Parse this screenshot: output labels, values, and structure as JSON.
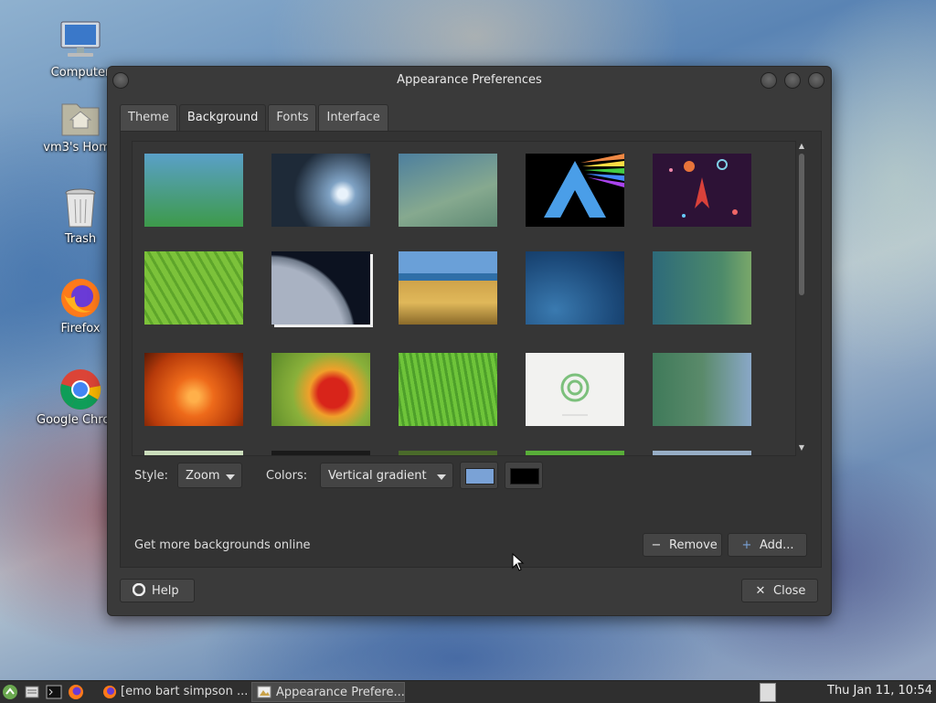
{
  "desktop": {
    "icons": [
      {
        "label": "Computer"
      },
      {
        "label": "vm3's Home"
      },
      {
        "label": "Trash"
      },
      {
        "label": "Firefox"
      },
      {
        "label": "Google Chrome"
      }
    ]
  },
  "window": {
    "title": "Appearance Preferences",
    "tabs": [
      "Theme",
      "Background",
      "Fonts",
      "Interface"
    ],
    "active_tab": "Background",
    "style_label": "Style:",
    "style_value": "Zoom",
    "colors_label": "Colors:",
    "colors_value": "Vertical gradient",
    "primary_color": "#7aa2d6",
    "secondary_color": "#000000",
    "get_more_label": "Get more backgrounds online",
    "remove_label": "Remove",
    "add_label": "Add...",
    "help_label": "Help",
    "close_label": "Close"
  },
  "taskbar": {
    "tasks": [
      "[emo bart simpson ...",
      "Appearance Prefere..."
    ],
    "clock": "Thu Jan 11, 10:54"
  }
}
